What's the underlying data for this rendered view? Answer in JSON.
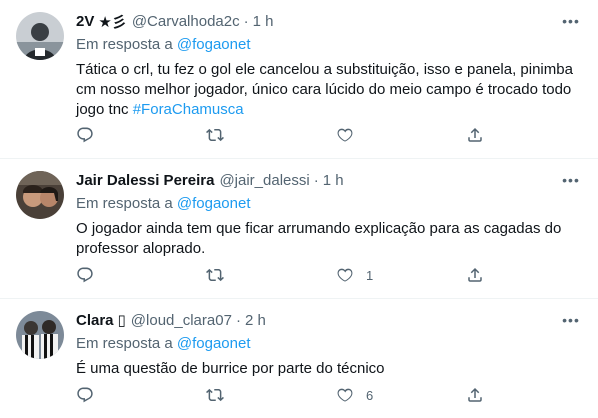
{
  "tweets": [
    {
      "name": "2V",
      "badge": "★彡",
      "handle": "@Carvalhoda2c",
      "time": "1 h",
      "reply_prefix": "Em resposta a",
      "reply_to": "@fogaonet",
      "text": "Tática o crl, tu fez o gol ele cancelou a substituição, isso e panela, pinimba cm nosso melhor jogador, único cara lúcido do meio campo é trocado todo jogo tnc",
      "hashtag": "#ForaChamusca",
      "likes": ""
    },
    {
      "name": "Jair Dalessi Pereira",
      "badge": "",
      "handle": "@jair_dalessi",
      "time": "1 h",
      "reply_prefix": "Em resposta a",
      "reply_to": "@fogaonet",
      "text": "O jogador ainda tem que ficar arrumando explicação para as cagadas do professor aloprado.",
      "hashtag": "",
      "likes": "1"
    },
    {
      "name": "Clara",
      "badge": "▯",
      "handle": "@loud_clara07",
      "time": "2 h",
      "reply_prefix": "Em resposta a",
      "reply_to": "@fogaonet",
      "text": "É uma questão de burrice por parte do técnico",
      "hashtag": "",
      "likes": "6"
    }
  ],
  "separator": "·",
  "more_glyph": "•••",
  "icons": [
    "more-icon",
    "reply-icon",
    "retweet-icon",
    "like-icon",
    "share-icon"
  ],
  "colors": {
    "link": "#1d9bf0",
    "secondary": "#536471",
    "text": "#0f1419",
    "border": "#eff3f4"
  }
}
